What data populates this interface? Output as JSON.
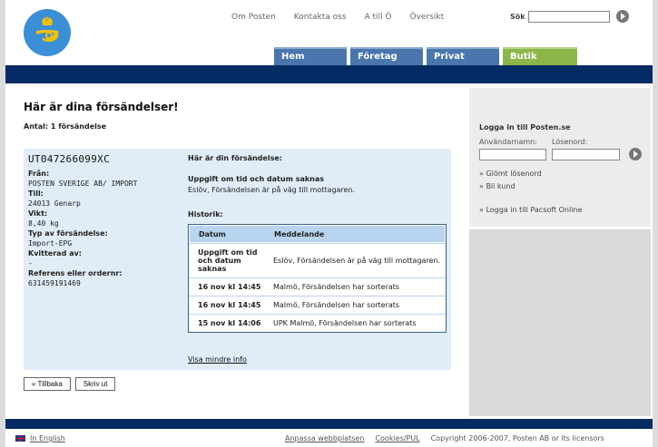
{
  "header": {
    "nav": [
      "Om Posten",
      "Kontakta oss",
      "A till Ö",
      "Översikt"
    ],
    "search_label": "Sök",
    "search_value": "",
    "tabs": [
      "Hem",
      "Företag",
      "Privat",
      "Butik"
    ]
  },
  "main": {
    "title": "Här är dina försändelser!",
    "count": "Antal: 1 försändelse",
    "shipment_id": "UT047266099XC",
    "details": [
      {
        "label": "Från:",
        "value": "POSTEN SVERIGE AB/ IMPORT"
      },
      {
        "label": "Till:",
        "value": "24013 Genarp"
      },
      {
        "label": "Vikt:",
        "value": "8,40 kg"
      },
      {
        "label": "Typ av försändelse:",
        "value": "Import-EPG"
      },
      {
        "label": "Kvitterad av:",
        "value": "-"
      },
      {
        "label": "Referens eller ordernr:",
        "value": "631459191469"
      }
    ],
    "heading": "Här är din försändelse:",
    "status_title": "Uppgift om tid och datum saknas",
    "status_msg": "Eslöv, Försändelsen är på väg till mottagaren.",
    "history_label": "Historik:",
    "history_headers": [
      "Datum",
      "Meddelande"
    ],
    "history": [
      {
        "date": "Uppgift om tid och datum saknas",
        "msg": "Eslöv, Försändelsen är på väg till mottagaren."
      },
      {
        "date": "16 nov kl 14:45",
        "msg": "Malmö, Försändelsen har sorterats"
      },
      {
        "date": "16 nov kl 14:45",
        "msg": "Malmö, Försändelsen har sorterats"
      },
      {
        "date": "15 nov kl 14:06",
        "msg": "UPK Malmö, Försändelsen har sorterats"
      }
    ],
    "less_info": "Visa mindre info",
    "back_button": "« Tillbaka",
    "print_button": "Skriv ut"
  },
  "sidebar": {
    "login_title": "Logga in till Posten.se",
    "username_label": "Användarnamn:",
    "password_label": "Lösenord:",
    "username_value": "",
    "password_value": "",
    "links": [
      "» Glömt lösenord",
      "» Bli kund",
      "» Logga in till Pacsoft Online"
    ]
  },
  "footer": {
    "english": "In English",
    "links": [
      "Anpassa webbplatsen",
      "Cookies/PUL"
    ],
    "copyright": "Copyright 2006-2007, Posten AB or its licensors"
  },
  "colors": {
    "navy": "#062a63",
    "tab_blue": "#4a76ad",
    "tab_green": "#8cb64a",
    "panel": "#e0ecf7",
    "logo": "#3b8fd6"
  }
}
